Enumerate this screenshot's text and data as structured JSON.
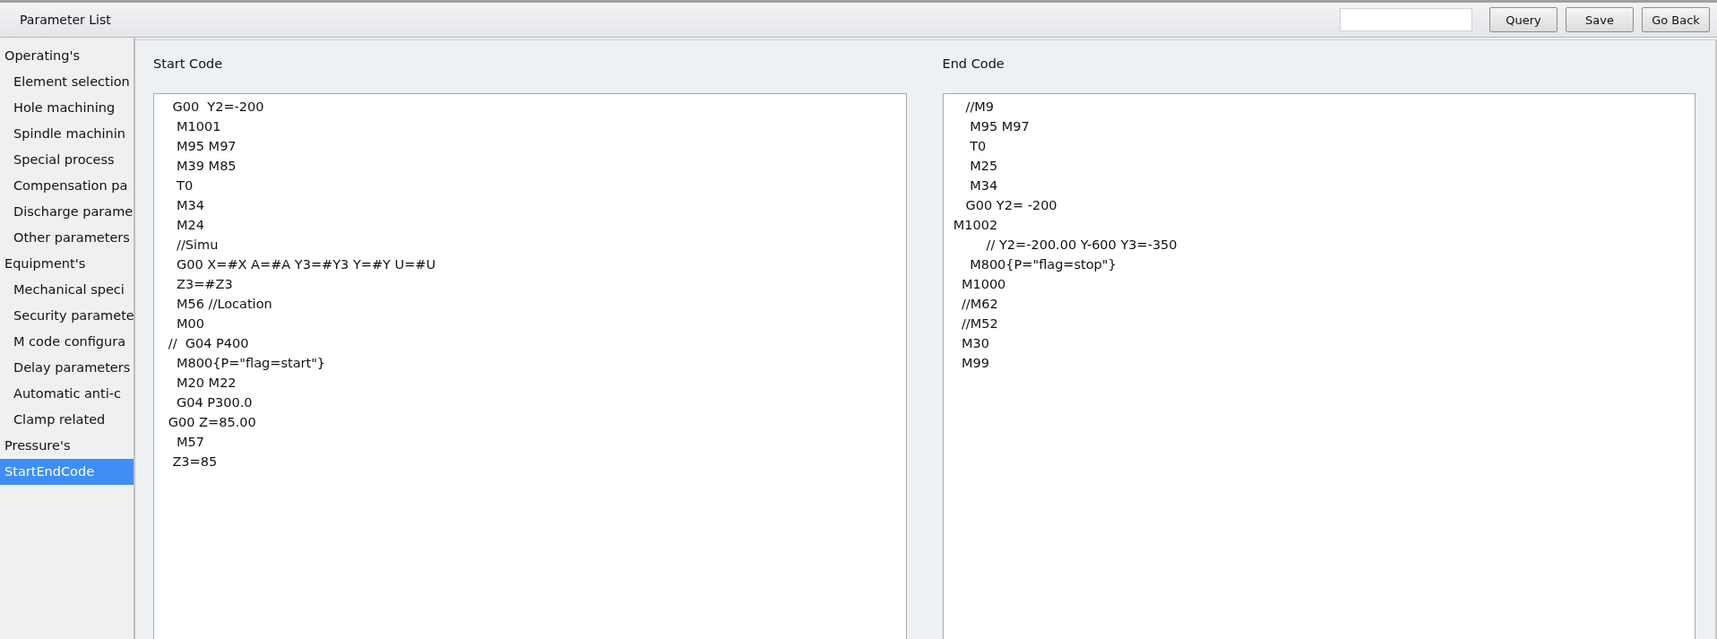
{
  "window": {
    "title": "Parameter List"
  },
  "toolbar": {
    "buttons": [
      "Query",
      "Save",
      "Go Back"
    ]
  },
  "sidebar": {
    "items": [
      {
        "label": "Operating's",
        "selected": false,
        "children": [
          {
            "label": "Element selection",
            "selected": false
          },
          {
            "label": "Hole machining",
            "selected": false
          },
          {
            "label": "Spindle machinin",
            "selected": false
          },
          {
            "label": "Special process",
            "selected": false
          },
          {
            "label": "Compensation pa",
            "selected": false
          },
          {
            "label": "Discharge parame",
            "selected": false
          },
          {
            "label": "Other parameters",
            "selected": false
          }
        ]
      },
      {
        "label": "Equipment's",
        "selected": false,
        "children": [
          {
            "label": "Mechanical speci",
            "selected": false
          },
          {
            "label": "Security paramete",
            "selected": false
          },
          {
            "label": "M code configura",
            "selected": false
          },
          {
            "label": "Delay parameters",
            "selected": false
          },
          {
            "label": "Automatic anti-c",
            "selected": false
          },
          {
            "label": "Clamp related",
            "selected": false
          }
        ]
      },
      {
        "label": "Pressure's",
        "selected": false
      },
      {
        "label": "StartEndCode",
        "selected": true
      }
    ]
  },
  "panels": [
    {
      "title": "Start Code",
      "lines": [
        "    G00  Y2=-200",
        "     M1001",
        "     M95 M97",
        "     M39 M85",
        "     T0",
        "     M34",
        "     M24",
        "     //Simu",
        "     G00 X=#X A=#A Y3=#Y3 Y=#Y U=#U",
        "     Z3=#Z3",
        "     M56 //Location",
        "     M00",
        "   //  G04 P400",
        "     M800{P=\"flag=start\"}",
        "     M20 M22",
        "     G04 P300.0",
        "   G00 Z=85.00",
        "     M57",
        "    Z3=85"
      ]
    },
    {
      "title": "End Code",
      "lines": [
        "     //M9",
        "      M95 M97",
        "      T0",
        "      M25",
        "      M34",
        "     G00 Y2= -200",
        "  M1002",
        "          // Y2=-200.00 Y-600 Y3=-350",
        "      M800{P=\"flag=stop\"}",
        "    M1000",
        "    //M62",
        "    //M52",
        "    M30",
        "    M99"
      ]
    }
  ]
}
